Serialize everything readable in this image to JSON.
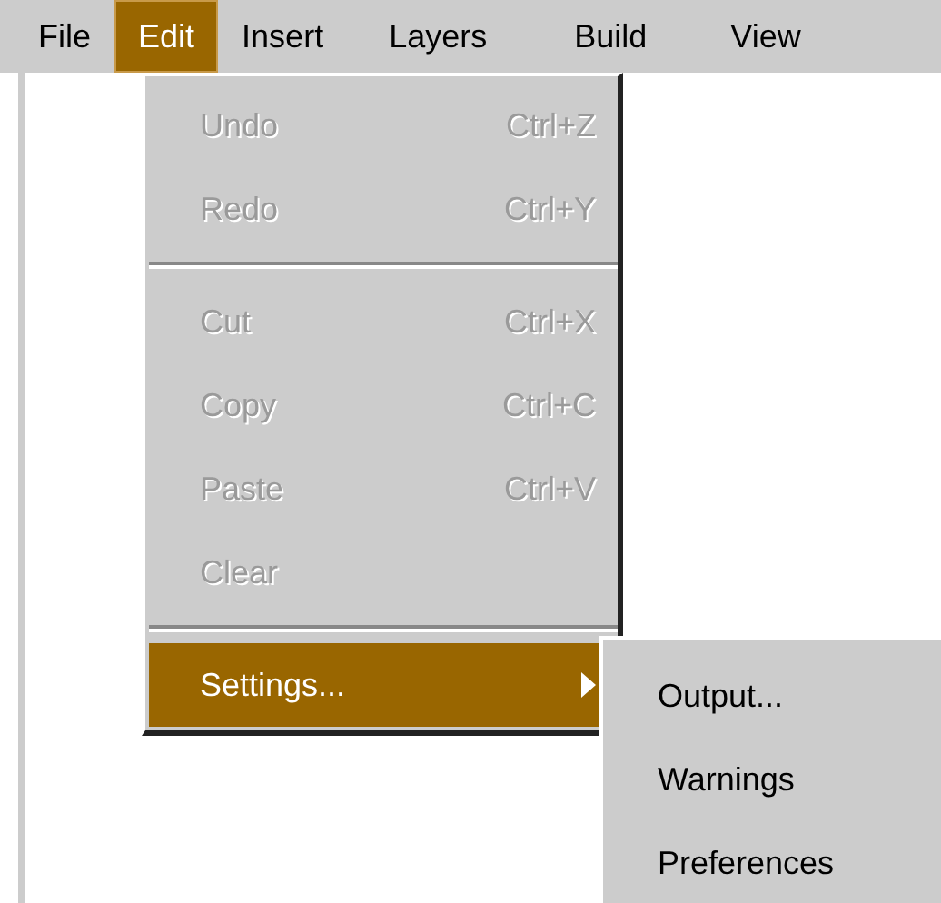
{
  "menubar": [
    {
      "label": "File",
      "selected": false
    },
    {
      "label": "Edit",
      "selected": true
    },
    {
      "label": "Insert",
      "selected": false
    },
    {
      "label": "Layers",
      "selected": false
    },
    {
      "label": "Build",
      "selected": false
    },
    {
      "label": "View",
      "selected": false
    }
  ],
  "edit_menu": [
    {
      "kind": "item",
      "label": "Undo",
      "shortcut": "Ctrl+Z",
      "disabled": true,
      "selected": false
    },
    {
      "kind": "item",
      "label": "Redo",
      "shortcut": "Ctrl+Y",
      "disabled": true,
      "selected": false
    },
    {
      "kind": "separator"
    },
    {
      "kind": "item",
      "label": "Cut",
      "shortcut": "Ctrl+X",
      "disabled": true,
      "selected": false
    },
    {
      "kind": "item",
      "label": "Copy",
      "shortcut": "Ctrl+C",
      "disabled": true,
      "selected": false
    },
    {
      "kind": "item",
      "label": "Paste",
      "shortcut": "Ctrl+V",
      "disabled": true,
      "selected": false
    },
    {
      "kind": "item",
      "label": "Clear",
      "disabled": true,
      "selected": false
    },
    {
      "kind": "separator"
    },
    {
      "kind": "submenu",
      "label": "Settings...",
      "disabled": false,
      "selected": true
    }
  ],
  "settings_submenu": [
    {
      "label": "Output...",
      "selected": false
    },
    {
      "label": "Warnings",
      "selected": false
    },
    {
      "label": "Preferences",
      "selected": false
    }
  ]
}
